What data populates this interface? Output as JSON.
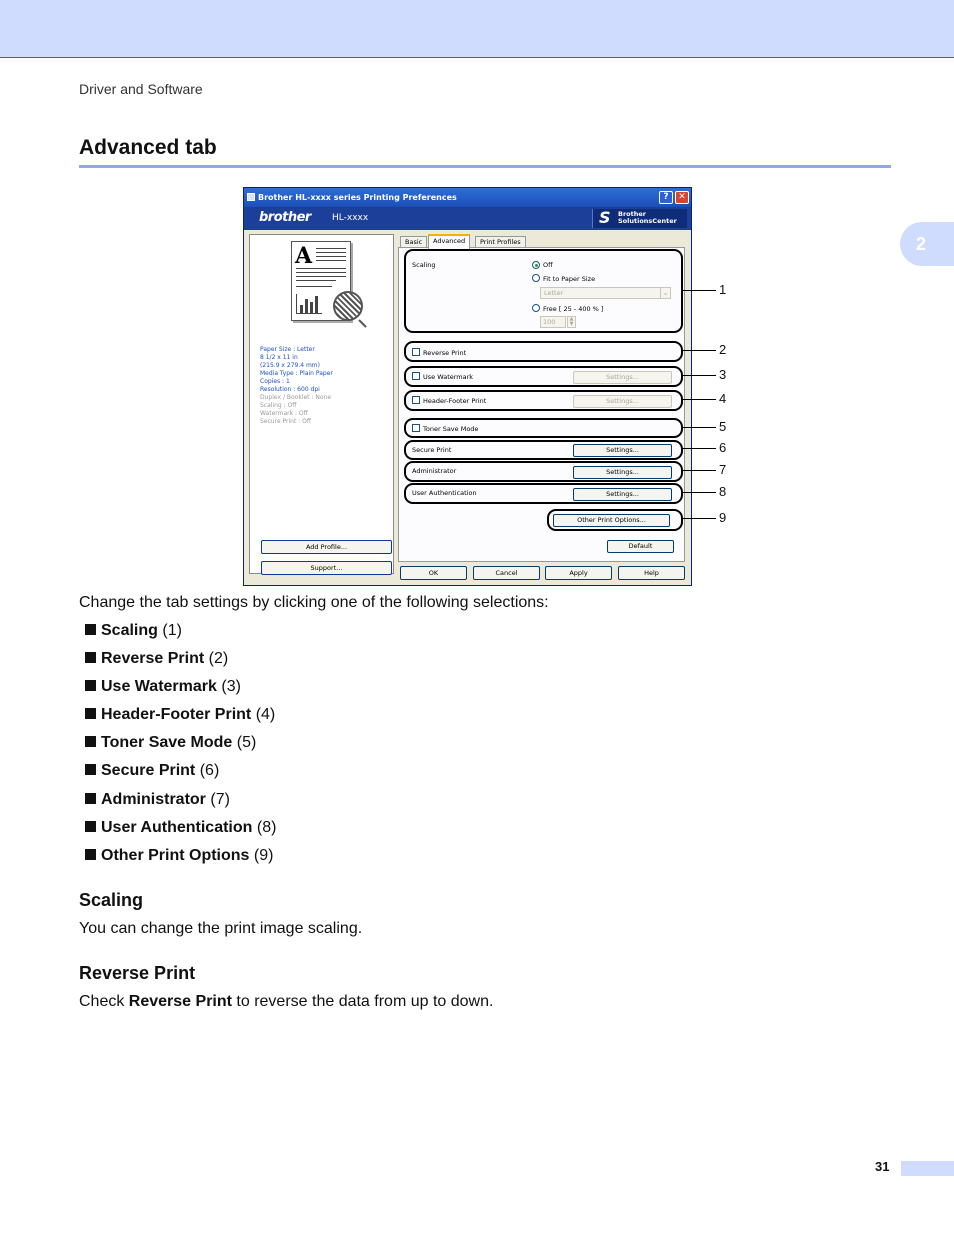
{
  "header": {
    "running_head": "Driver and Software",
    "chapter_number": "2"
  },
  "section": {
    "title": "Advanced tab"
  },
  "dialog": {
    "title": "Brother HL-xxxx series Printing Preferences",
    "brand": {
      "logo": "brother",
      "model": "HL-xxxx",
      "center_line1": "Brother",
      "center_line2": "SolutionsCenter"
    },
    "preview_letter": "A",
    "info": {
      "paper_size": "Paper Size : Letter",
      "size_in": "8 1/2 x 11 in",
      "size_mm": "(215.9 x 279.4 mm)",
      "media_type": "Media Type : Plain Paper",
      "copies": "Copies : 1",
      "resolution": "Resolution : 600 dpi",
      "duplex": "Duplex / Booklet : None",
      "scaling": "Scaling : Off",
      "watermark": "Watermark : Off",
      "secure_print": "Secure Print : Off"
    },
    "side_buttons": {
      "add_profile": "Add Profile...",
      "support": "Support..."
    },
    "tabs": [
      "Basic",
      "Advanced",
      "Print Profiles"
    ],
    "scaling": {
      "label": "Scaling",
      "options": {
        "off": "Off",
        "fit": "Fit to Paper Size",
        "free": "Free [ 25 - 400 % ]"
      },
      "paper_select": "Letter",
      "percent_value": "100"
    },
    "rows": {
      "reverse_print": "Reverse Print",
      "use_watermark": "Use Watermark",
      "header_footer": "Header-Footer Print",
      "toner_save": "Toner Save Mode",
      "secure_print": "Secure Print",
      "administrator": "Administrator",
      "user_authentication": "User Authentication"
    },
    "settings_label": "Settings...",
    "other_print_options": "Other Print Options...",
    "default_label": "Default",
    "bottom": {
      "ok": "OK",
      "cancel": "Cancel",
      "apply": "Apply",
      "help": "Help"
    }
  },
  "callout_numbers": [
    "1",
    "2",
    "3",
    "4",
    "5",
    "6",
    "7",
    "8",
    "9"
  ],
  "intro": "Change the tab settings by clicking one of the following selections:",
  "selections": [
    {
      "name": "Scaling",
      "ref": "(1)"
    },
    {
      "name": "Reverse Print",
      "ref": "(2)"
    },
    {
      "name": "Use Watermark",
      "ref": "(3)"
    },
    {
      "name": "Header-Footer Print",
      "ref": "(4)"
    },
    {
      "name": "Toner Save Mode",
      "ref": "(5)"
    },
    {
      "name": "Secure Print",
      "ref": "(6)"
    },
    {
      "name": "Administrator",
      "ref": "(7)"
    },
    {
      "name": "User Authentication",
      "ref": "(8)"
    },
    {
      "name": "Other Print Options",
      "ref": "(9)"
    }
  ],
  "scaling_section": {
    "heading": "Scaling",
    "text": "You can change the print image scaling."
  },
  "reverse_section": {
    "heading": "Reverse Print",
    "text_before": "Check ",
    "bold": "Reverse Print",
    "text_after": " to reverse the data from up to down."
  },
  "page_number": "31"
}
